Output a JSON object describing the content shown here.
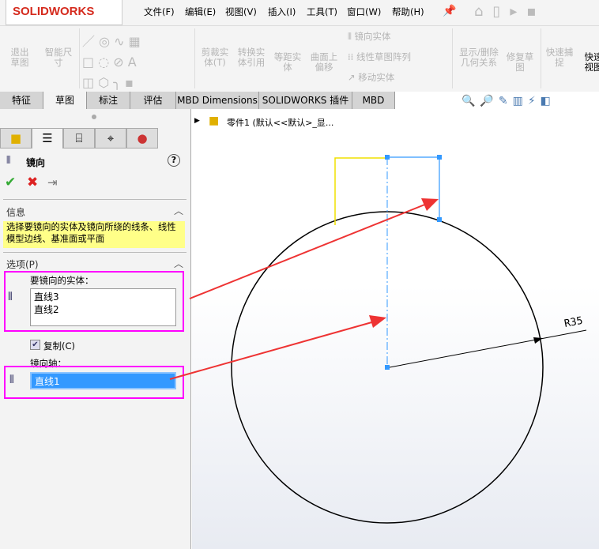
{
  "app": {
    "logo": "SOLIDWORKS"
  },
  "menu": [
    "文件(F)",
    "编辑(E)",
    "视图(V)",
    "插入(I)",
    "工具(T)",
    "窗口(W)",
    "帮助(H)"
  ],
  "ribbon": {
    "exit_sketch": "退出草图",
    "smart_dim": "智能尺寸",
    "trim": "剪裁实体(T)",
    "convert": "转换实体引用",
    "offset": "等距实体",
    "surface_offset": "曲面上偏移",
    "mirror": "镜向实体",
    "linear_pattern": "线性草图阵列",
    "move": "移动实体",
    "show_delete": "显示/删除几何关系",
    "repair": "修复草图",
    "quick_snap": "快速捕捉",
    "quick_view": "快速视图"
  },
  "tabs": [
    "特征",
    "草图",
    "标注",
    "评估",
    "MBD Dimensions",
    "SOLIDWORKS 插件",
    "MBD"
  ],
  "active_tab": "草图",
  "tree": {
    "part": "零件1  (默认<<默认>_显..."
  },
  "panel": {
    "title": "镜向",
    "info_header": "信息",
    "info_text": "选择要镜向的实体及镜向所绕的线条、线性模型边线、基准面或平面",
    "options_header": "选项(P)",
    "entities_label": "要镜向的实体：",
    "entities": [
      "直线3",
      "直线2"
    ],
    "copy_label": "复制(C)",
    "copy_checked": true,
    "axis_label": "镜向轴：",
    "axis_value": "直线1"
  },
  "dimension": {
    "label": "R35"
  },
  "colors": {
    "highlight": "#ff00ff",
    "arrow": "#ee3333",
    "selection": "#3399ff",
    "info_bg": "#ffff88"
  }
}
